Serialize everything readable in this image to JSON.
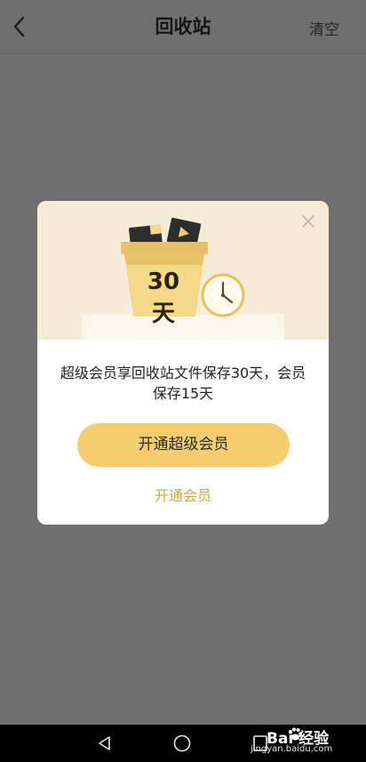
{
  "header": {
    "title": "回收站",
    "clear_label": "清空"
  },
  "dialog": {
    "badge_text": "30天",
    "message": "超级会员享回收站文件保存30天，会员保存15天",
    "primary_button": "开通超级会员",
    "secondary_link": "开通会员",
    "accent_color": "#f3cd6f",
    "link_color": "#d9a04a"
  },
  "watermark": {
    "brand": "Bai  经验",
    "url": "jingyan.baidu.com"
  },
  "icons": {
    "back": "chevron-left-icon",
    "close": "close-icon",
    "clock": "clock-icon",
    "nav_back": "triangle-back-icon",
    "nav_home": "circle-home-icon",
    "nav_recent": "square-recent-icon"
  }
}
